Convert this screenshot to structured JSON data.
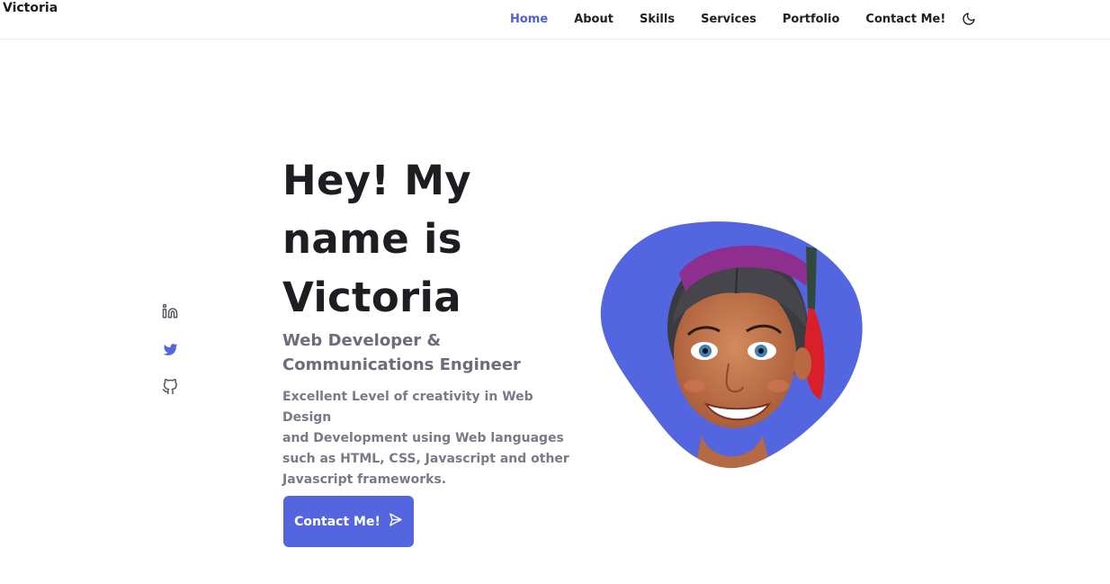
{
  "header": {
    "logo": "Victoria",
    "nav": [
      {
        "label": "Home",
        "active": true
      },
      {
        "label": "About",
        "active": false
      },
      {
        "label": "Skills",
        "active": false
      },
      {
        "label": "Services",
        "active": false
      },
      {
        "label": "Portfolio",
        "active": false
      },
      {
        "label": "Contact Me!",
        "active": false
      }
    ],
    "theme_toggle_icon": "moon-icon"
  },
  "social": [
    {
      "icon": "linkedin-icon"
    },
    {
      "icon": "twitter-icon"
    },
    {
      "icon": "github-icon"
    }
  ],
  "hero": {
    "title_line1": "Hey! My",
    "title_line2": "name is",
    "title_line3": "Victoria",
    "subtitle_line1": "Web Developer &",
    "subtitle_line2": "Communications Engineer",
    "description_line1": "Excellent Level of creativity in Web Design",
    "description_line2": "and Development using Web languages",
    "description_line3": "such as HTML, CSS, Javascript and other",
    "description_line4": "Javascript frameworks.",
    "cta_label": "Contact Me!",
    "cta_icon": "send-icon"
  },
  "colors": {
    "accent": "#5366df",
    "nav_active": "#4f5fdc",
    "text_dark": "#1d1d22",
    "text_muted": "#787a86"
  }
}
